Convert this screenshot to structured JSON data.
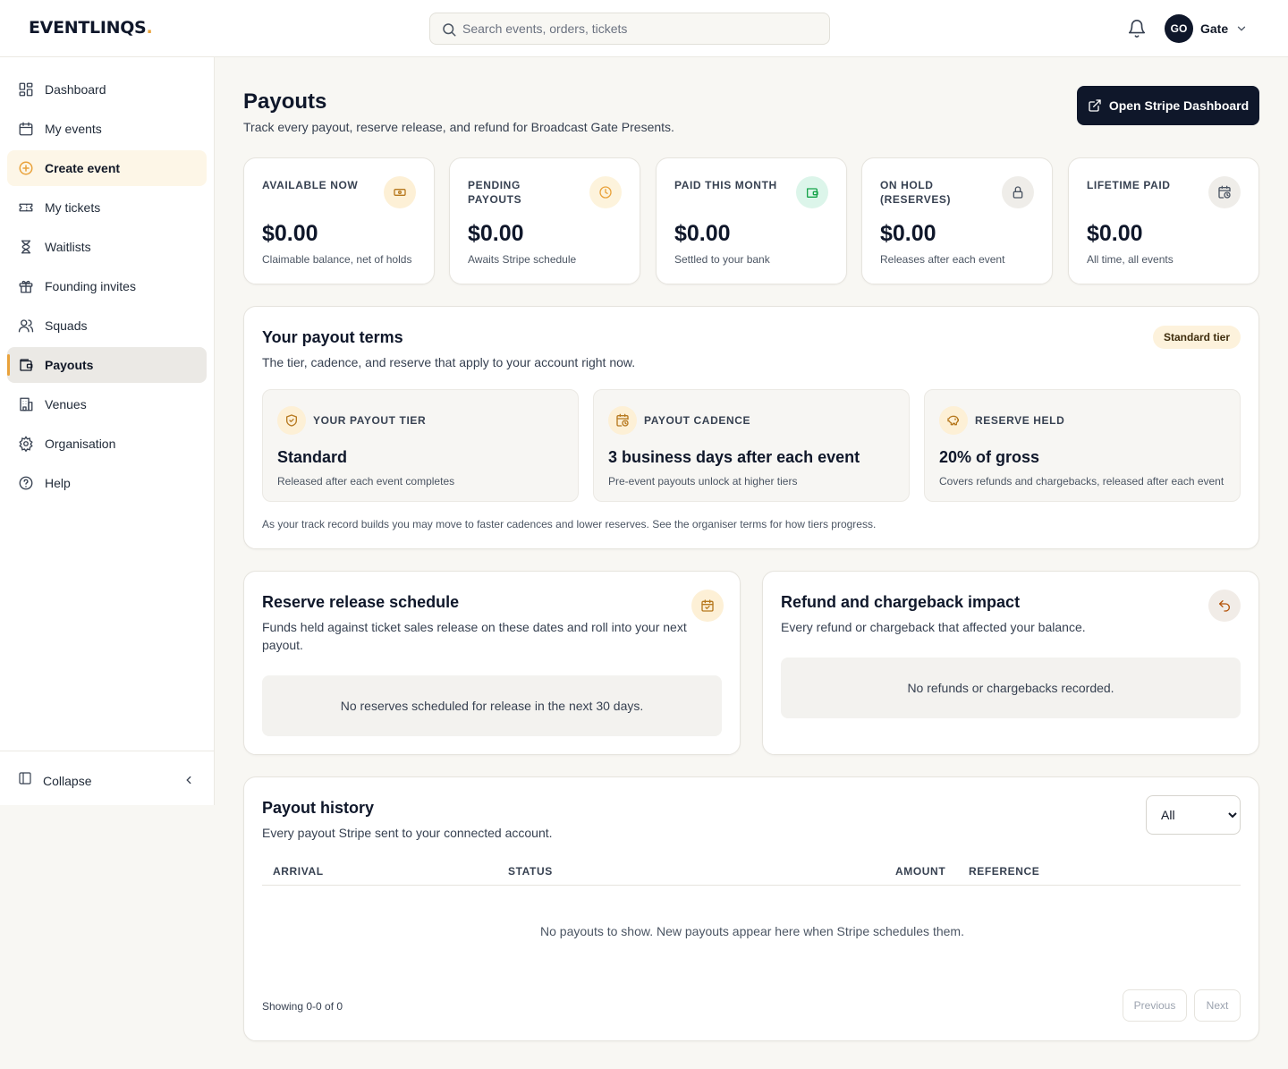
{
  "brand": {
    "name": "EVENTLINQS",
    "dot": ".",
    "accent": "#e9a23b",
    "dark": "#0f172a"
  },
  "search": {
    "placeholder": "Search events, orders, tickets",
    "icon": "search-icon"
  },
  "user": {
    "initials": "GO",
    "name": "Gate"
  },
  "sidebar": {
    "items": [
      {
        "label": "Dashboard",
        "icon": "dashboard-icon"
      },
      {
        "label": "My events",
        "icon": "calendar-icon"
      },
      {
        "label": "Create event",
        "icon": "plus-circle-icon"
      },
      {
        "label": "My tickets",
        "icon": "ticket-icon"
      },
      {
        "label": "Waitlists",
        "icon": "hourglass-icon"
      },
      {
        "label": "Founding invites",
        "icon": "gift-icon"
      },
      {
        "label": "Squads",
        "icon": "users-icon"
      },
      {
        "label": "Payouts",
        "icon": "wallet-icon"
      },
      {
        "label": "Venues",
        "icon": "building-icon"
      },
      {
        "label": "Organisation",
        "icon": "gear-icon"
      },
      {
        "label": "Help",
        "icon": "help-circle-icon"
      }
    ],
    "active": "Payouts",
    "collapse_label": "Collapse"
  },
  "page": {
    "title": "Payouts",
    "subtitle": "Track every payout, reserve release, and refund for Broadcast Gate Presents.",
    "stripe_button": "Open Stripe Dashboard"
  },
  "stats": [
    {
      "label": "AVAILABLE NOW",
      "value": "$0.00",
      "hint": "Claimable balance, net of holds",
      "icon": "cash-icon"
    },
    {
      "label": "PENDING PAYOUTS",
      "value": "$0.00",
      "hint": "Awaits Stripe schedule",
      "icon": "clock-icon"
    },
    {
      "label": "PAID THIS MONTH",
      "value": "$0.00",
      "hint": "Settled to your bank",
      "icon": "wallet-icon"
    },
    {
      "label": "ON HOLD (RESERVES)",
      "value": "$0.00",
      "hint": "Releases after each event",
      "icon": "lock-icon"
    },
    {
      "label": "LIFETIME PAID",
      "value": "$0.00",
      "hint": "All time, all events",
      "icon": "calendar-clock-icon"
    }
  ],
  "terms": {
    "title": "Your payout terms",
    "subtitle": "The tier, cadence, and reserve that apply to your account right now.",
    "badge": "Standard tier",
    "boxes": [
      {
        "label": "YOUR PAYOUT TIER",
        "value": "Standard",
        "hint": "Released after each event completes",
        "icon": "shield-check-icon"
      },
      {
        "label": "PAYOUT CADENCE",
        "value": "3 business days after each event",
        "hint": "Pre-event payouts unlock at higher tiers",
        "icon": "calendar-clock-icon"
      },
      {
        "label": "RESERVE HELD",
        "value": "20% of gross",
        "hint": "Covers refunds and chargebacks, released after each event",
        "icon": "piggy-bank-icon"
      }
    ],
    "note": "As your track record builds you may move to faster cadences and lower reserves. See the organiser terms for how tiers progress."
  },
  "reserve": {
    "title": "Reserve release schedule",
    "subtitle": "Funds held against ticket sales release on these dates and roll into your next payout.",
    "empty": "No reserves scheduled for release in the next 30 days.",
    "icon": "calendar-check-icon"
  },
  "refunds": {
    "title": "Refund and chargeback impact",
    "subtitle": "Every refund or chargeback that affected your balance.",
    "empty": "No refunds or chargebacks recorded.",
    "icon": "undo-icon"
  },
  "history": {
    "title": "Payout history",
    "subtitle": "Every payout Stripe sent to your connected account.",
    "filter": {
      "selected": "All"
    },
    "columns": [
      "ARRIVAL",
      "STATUS",
      "AMOUNT",
      "REFERENCE"
    ],
    "empty": "No payouts to show. New payouts appear here when Stripe schedules them.",
    "showing": "Showing 0-0 of 0",
    "prev": "Previous",
    "next": "Next"
  }
}
